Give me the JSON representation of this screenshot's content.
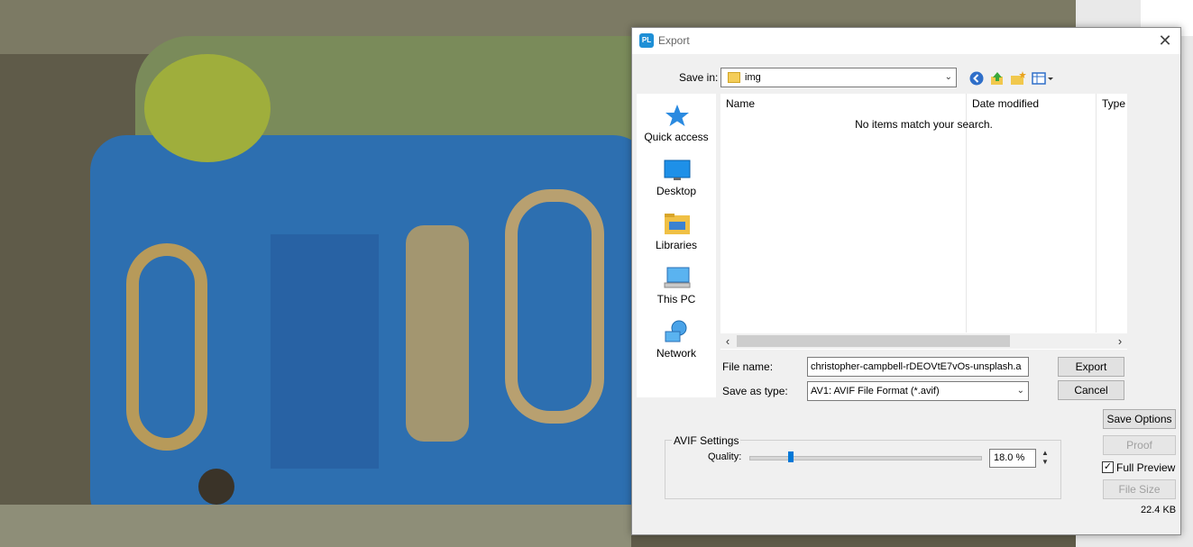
{
  "dialog": {
    "app_icon": "PL",
    "title": "Export",
    "close_glyph": "✕"
  },
  "toolbar": {
    "save_in_label": "Save in:",
    "save_in_value": "img",
    "icons": [
      "back-icon",
      "up-folder-icon",
      "new-folder-icon",
      "view-menu-icon"
    ]
  },
  "places": [
    {
      "label": "Quick access",
      "icon": "quick-access-star-icon"
    },
    {
      "label": "Desktop",
      "icon": "desktop-icon"
    },
    {
      "label": "Libraries",
      "icon": "libraries-folder-icon"
    },
    {
      "label": "This PC",
      "icon": "this-pc-icon"
    },
    {
      "label": "Network",
      "icon": "network-icon"
    }
  ],
  "filelist": {
    "columns": [
      "Name",
      "Date modified",
      "Type"
    ],
    "empty_message": "No items match your search."
  },
  "form": {
    "file_name_label": "File name:",
    "file_name_value": "christopher-campbell-rDEOVtE7vOs-unsplash.a",
    "save_as_type_label": "Save as type:",
    "save_as_type_value": "AV1: AVIF File Format (*.avif)",
    "export_label": "Export",
    "cancel_label": "Cancel"
  },
  "options": {
    "save_options_label": "Save Options",
    "proof_label": "Proof",
    "full_preview_label": "Full Preview",
    "full_preview_checked": true,
    "file_size_button_label": "File Size",
    "file_size_value": "22.4 KB"
  },
  "avif": {
    "group_title": "AVIF Settings",
    "quality_label": "Quality:",
    "quality_value": "18.0 %",
    "quality_fraction": 0.18
  },
  "colors": {
    "accent": "#0078d7",
    "app_icon": "#1e8fd6"
  }
}
